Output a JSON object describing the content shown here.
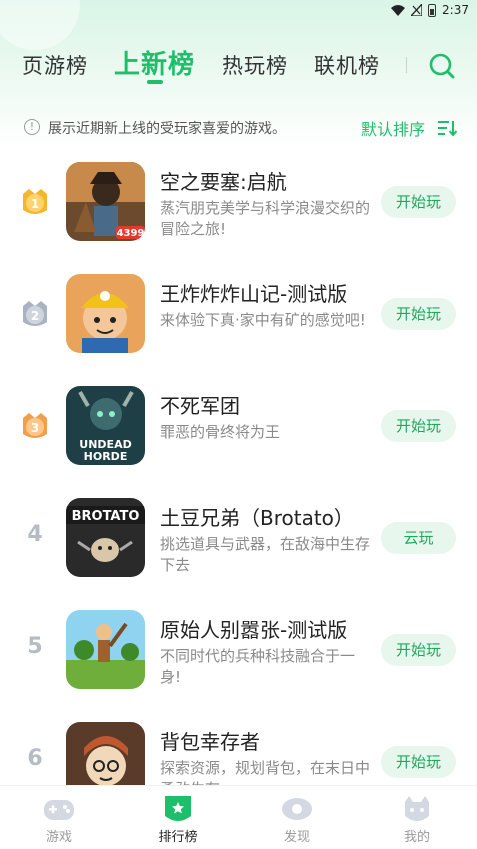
{
  "status_bar": {
    "time": "2:37"
  },
  "tabs": [
    {
      "label": "页游榜",
      "active": false
    },
    {
      "label": "上新榜",
      "active": true
    },
    {
      "label": "热玩榜",
      "active": false
    },
    {
      "label": "联机榜",
      "active": false
    }
  ],
  "info": {
    "text": "展示近期新上线的受玩家喜爱的游戏。",
    "sort_label": "默认排序"
  },
  "games": [
    {
      "rank": "1",
      "name": "空之要塞:启航",
      "desc": "蒸汽朋克美学与科学浪漫交织的冒险之旅!",
      "button": "开始玩",
      "icon_badge": "4399"
    },
    {
      "rank": "2",
      "name": "王炸炸炸山记-测试版",
      "desc": "来体验下真·家中有矿的感觉吧!",
      "button": "开始玩"
    },
    {
      "rank": "3",
      "name": "不死军团",
      "desc": "罪恶的骨终将为王",
      "button": "开始玩",
      "icon_text_1": "UNDEAD",
      "icon_text_2": "HORDE"
    },
    {
      "rank": "4",
      "name": "土豆兄弟（Brotato）",
      "desc": "挑选道具与武器，在敌海中生存下去",
      "button": "云玩",
      "icon_text": "BROTATO"
    },
    {
      "rank": "5",
      "name": "原始人别嚣张-测试版",
      "desc": "不同时代的兵种科技融合于一身!",
      "button": "开始玩"
    },
    {
      "rank": "6",
      "name": "背包幸存者",
      "desc": "探索资源，规划背包，在末日中勇敢生存",
      "button": "开始玩"
    }
  ],
  "bottom_nav": [
    {
      "label": "游戏",
      "active": false
    },
    {
      "label": "排行榜",
      "active": true
    },
    {
      "label": "发现",
      "active": false
    },
    {
      "label": "我的",
      "active": false
    }
  ],
  "colors": {
    "accent": "#1fbe6b",
    "gold": "#f5b52e",
    "silver": "#aab3c2",
    "bronze": "#f0a04b"
  }
}
